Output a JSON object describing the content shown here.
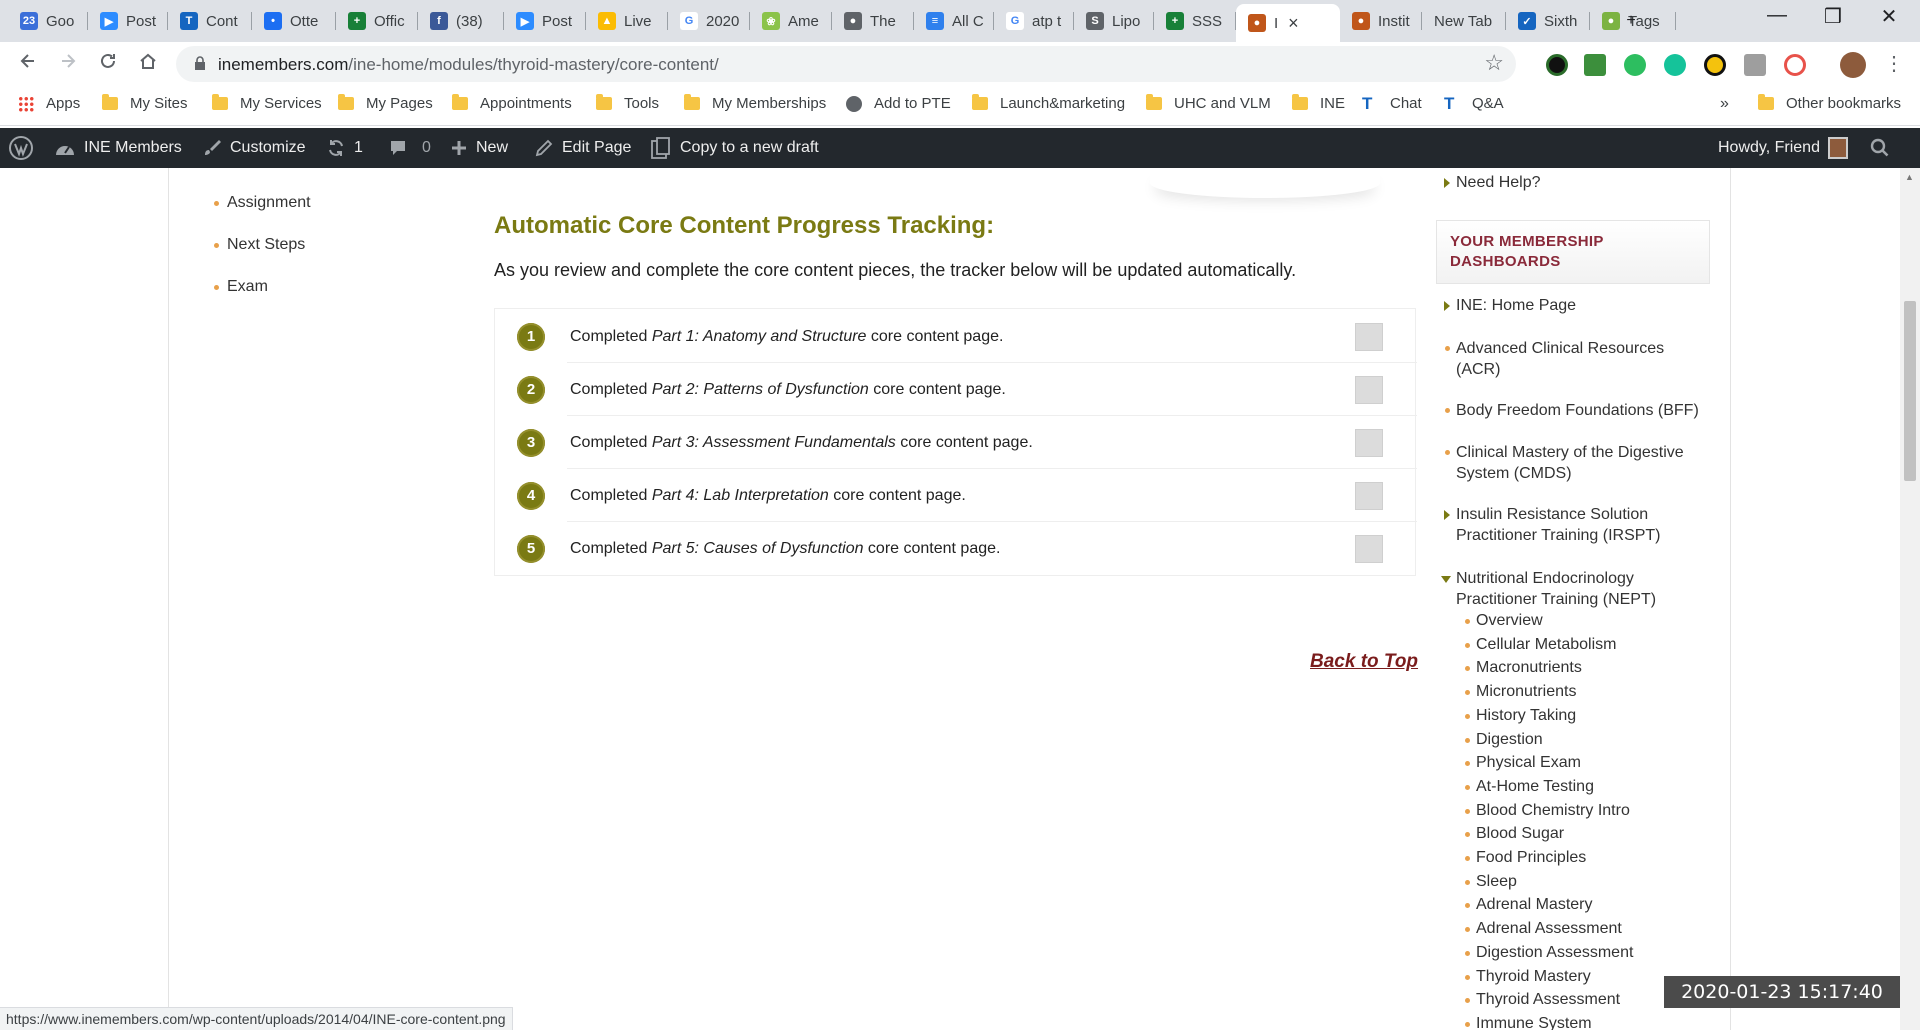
{
  "browser": {
    "tabs": [
      {
        "label": "Goo",
        "color": "#3b6fd9",
        "glyph": "23"
      },
      {
        "label": "Post",
        "color": "#2d8cff",
        "glyph": "▶"
      },
      {
        "label": "Cont",
        "color": "#1565c0",
        "glyph": "T"
      },
      {
        "label": "Otte",
        "color": "#1c6ef2",
        "glyph": "•"
      },
      {
        "label": "Offic",
        "color": "#188038",
        "glyph": "+"
      },
      {
        "label": "(38)",
        "color": "#3b5998",
        "glyph": "f"
      },
      {
        "label": "Post",
        "color": "#2d8cff",
        "glyph": "▶"
      },
      {
        "label": "Live",
        "color": "#fbbc04",
        "glyph": "▲"
      },
      {
        "label": "2020",
        "color": "#ffffff",
        "glyph": "G"
      },
      {
        "label": "Ame",
        "color": "#8bc34a",
        "glyph": "❀"
      },
      {
        "label": "The",
        "color": "#5f6368",
        "glyph": "●"
      },
      {
        "label": "All C",
        "color": "#2f80ed",
        "glyph": "≡"
      },
      {
        "label": "atp t",
        "color": "#ffffff",
        "glyph": "G"
      },
      {
        "label": "Lipo",
        "color": "#5f6368",
        "glyph": "S"
      },
      {
        "label": "SSS",
        "color": "#188038",
        "glyph": "+"
      },
      {
        "label": "I",
        "color": "#c0561a",
        "glyph": "●",
        "active": true
      },
      {
        "label": "Instit",
        "color": "#c0561a",
        "glyph": "●"
      },
      {
        "label": "New Tab",
        "color": "",
        "glyph": ""
      },
      {
        "label": "Sixth",
        "color": "#1565c0",
        "glyph": "✓"
      },
      {
        "label": "Tags",
        "color": "#7cb342",
        "glyph": "●"
      }
    ],
    "new_tab": "+",
    "window": {
      "minimize": "—",
      "maximize": "❒",
      "close": "✕"
    },
    "url_host": "inemembers.com",
    "url_path": "/ine-home/modules/thyroid-mastery/core-content/",
    "bookmarks": [
      "Apps",
      "My Sites",
      "My Services",
      "My Pages",
      "Appointments",
      "Tools",
      "My Memberships",
      "Add to PTE",
      "Launch&marketing",
      "UHC and VLM",
      "INE",
      "Chat",
      "Q&A"
    ],
    "bookmarks_more": "»",
    "other_bookmarks": "Other bookmarks",
    "status_url": "https://www.inemembers.com/wp-content/uploads/2014/04/INE-core-content.png",
    "timestamp": "2020-01-23  15:17:40"
  },
  "adminbar": {
    "site": "INE Members",
    "customize": "Customize",
    "updates": "1",
    "comments": "0",
    "new": "New",
    "edit": "Edit Page",
    "copy": "Copy to a new draft",
    "howdy": "Howdy, Friend"
  },
  "left_nav": [
    "Assignment",
    "Next Steps",
    "Exam"
  ],
  "main": {
    "title": "Automatic Core Content Progress Tracking:",
    "desc": "As you review and complete the core content pieces, the tracker below will be updated automatically.",
    "rows": [
      {
        "num": "1",
        "pre": "Completed ",
        "em": "Part 1: Anatomy and Structure",
        "post": " core content page."
      },
      {
        "num": "2",
        "pre": "Completed ",
        "em": "Part 2: Patterns of Dysfunction",
        "post": " core content page."
      },
      {
        "num": "3",
        "pre": "Completed ",
        "em": "Part 3: Assessment Fundamentals",
        "post": " core content page."
      },
      {
        "num": "4",
        "pre": "Completed ",
        "em": "Part 4: Lab Interpretation",
        "post": " core content page."
      },
      {
        "num": "5",
        "pre": "Completed ",
        "em": "Part 5: Causes of Dysfunction",
        "post": " core content page."
      }
    ],
    "back_to_top": "Back to Top"
  },
  "sidebar": {
    "need_help": "Need Help?",
    "dash_title_1": "YOUR MEMBERSHIP",
    "dash_title_2": "DASHBOARDS",
    "links": [
      {
        "l1": "INE: Home Page",
        "l2": "",
        "marker": "tri"
      },
      {
        "l1": "Advanced Clinical Resources",
        "l2": "(ACR)",
        "marker": "dot"
      },
      {
        "l1": "Body Freedom Foundations (BFF)",
        "l2": "",
        "marker": "dot"
      },
      {
        "l1": "Clinical Mastery of the Digestive",
        "l2": "System (CMDS)",
        "marker": "dot"
      },
      {
        "l1": "Insulin Resistance Solution",
        "l2": "Practitioner Training (IRSPT)",
        "marker": "tri"
      },
      {
        "l1": "Nutritional Endocrinology",
        "l2": "Practitioner Training (NEPT)",
        "marker": "tri-down"
      }
    ],
    "nept_items": [
      "Overview",
      "Cellular Metabolism",
      "Macronutrients",
      "Micronutrients",
      "History Taking",
      "Digestion",
      "Physical Exam",
      "At-Home Testing",
      "Blood Chemistry Intro",
      "Blood Sugar",
      "Food Principles",
      "Sleep",
      "Adrenal Mastery",
      "Adrenal Assessment",
      "Digestion Assessment",
      "Thyroid Mastery",
      "Thyroid Assessment",
      "Immune System"
    ]
  }
}
